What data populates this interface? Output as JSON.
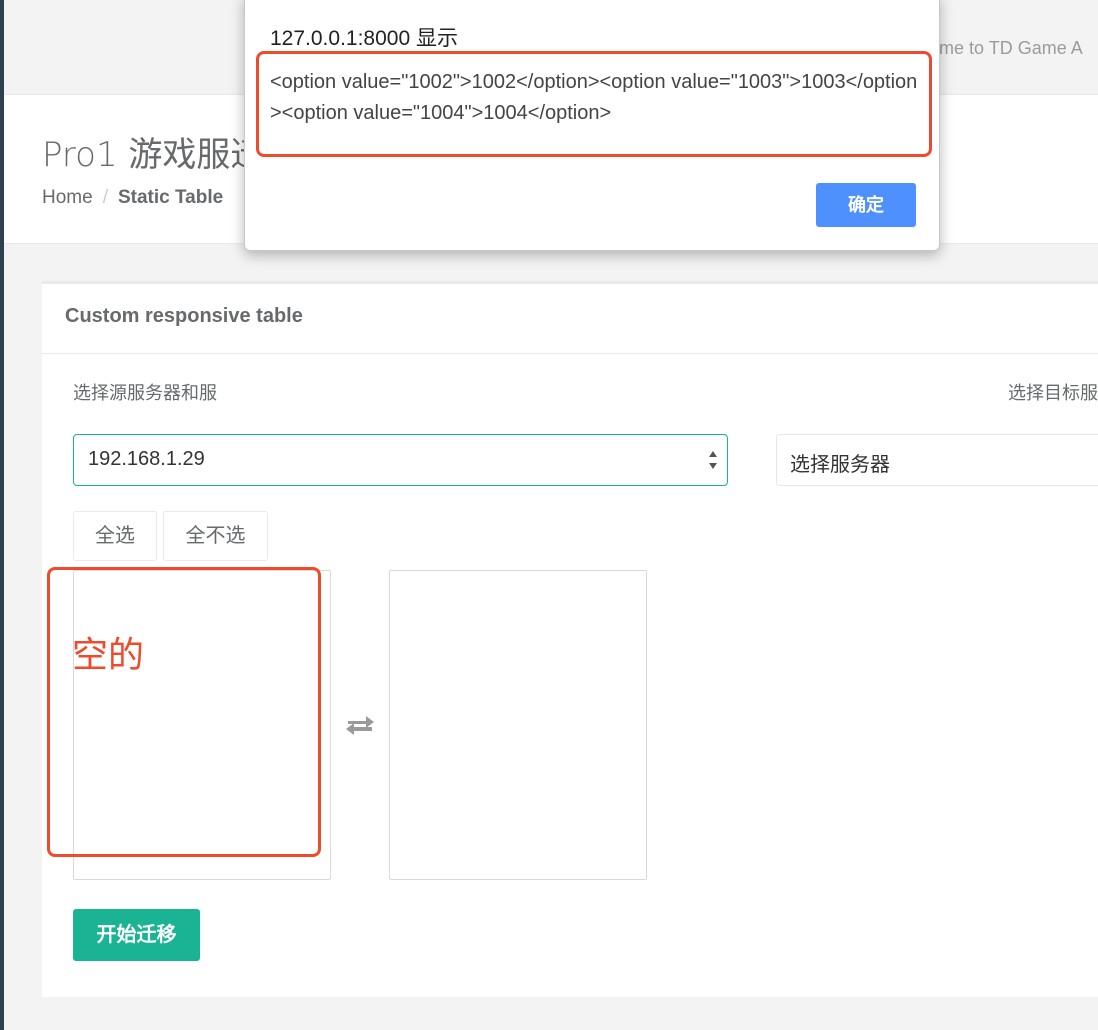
{
  "navbar": {
    "welcome": "me to TD Game A"
  },
  "page_heading": {
    "title": "Pro1 游戏服迁",
    "breadcrumb": {
      "home": "Home",
      "separator": "/",
      "active": "Static Table"
    }
  },
  "panel": {
    "title": "Custom responsive table",
    "source_label": "选择源服务器和服",
    "target_label": "选择目标服",
    "source_select_value": "192.168.1.29",
    "target_select_value": "选择服务器",
    "select_all_label": "全选",
    "select_none_label": "全不选",
    "start_button_label": "开始迁移"
  },
  "annotation": {
    "text": "空的",
    "color": "#f04a2c"
  },
  "alert": {
    "title": "127.0.0.1:8000 显示",
    "message": "<option value=\"1002\">1002</option><option value=\"1003\">1003</option><option value=\"1004\">1004</option>",
    "ok_label": "确定"
  },
  "colors": {
    "primary": "#1ab394",
    "dialog_button": "#4d90fe",
    "annotation": "#f04a2c",
    "sidebar_edge": "#2f4050"
  },
  "icons": {
    "transfer": "exchange-arrows-icon",
    "select": "select-up-down-arrows-icon"
  }
}
